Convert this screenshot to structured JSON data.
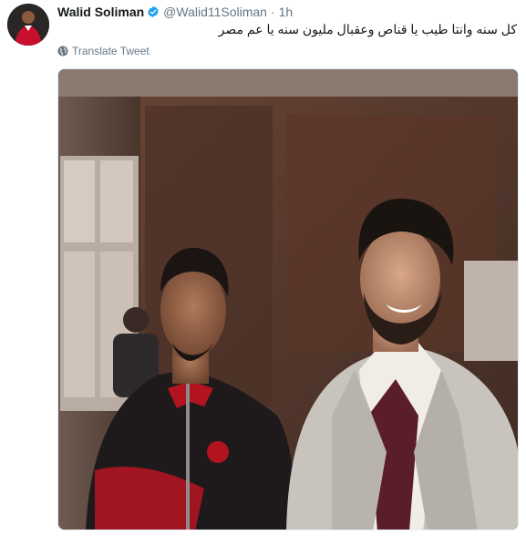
{
  "tweet": {
    "display_name": "Walid Soliman",
    "verified": true,
    "handle": "@Walid11Soliman",
    "separator": "·",
    "time": "1h",
    "text": "كل سنه وانتا طيب يا قناص وعقبال مليون سنه يا عم مصر",
    "translate_label": "Translate Tweet",
    "avatar_icon": "user-avatar",
    "media_description_icon": "photo"
  },
  "colors": {
    "name": "#14171a",
    "secondary": "#657786",
    "verified_badge": "#1da1f2",
    "background": "#ffffff"
  }
}
